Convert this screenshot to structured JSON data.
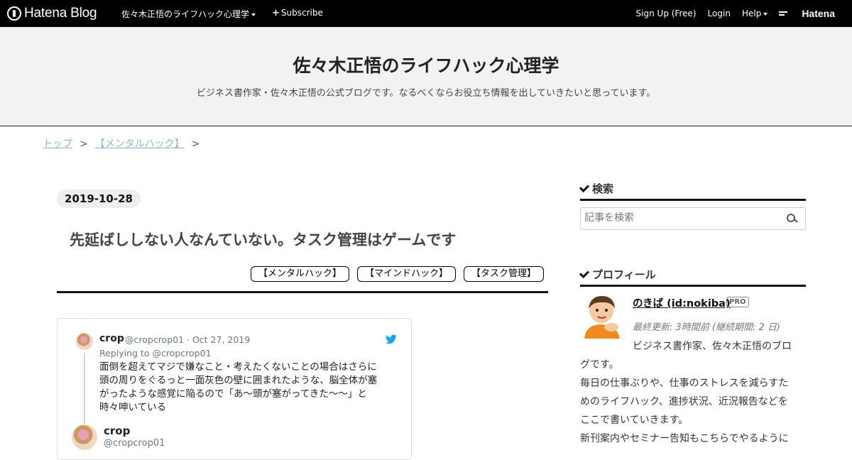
{
  "topbar": {
    "logo_text": "Hatena Blog",
    "blog_menu": "佐々木正悟のライフハック心理学",
    "subscribe": "Subscribe",
    "signup": "Sign Up (Free)",
    "login": "Login",
    "help": "Help",
    "hatena_brand": "Hatena"
  },
  "header": {
    "title": "佐々木正悟のライフハック心理学",
    "description": "ビジネス書作家・佐々木正悟の公式ブログです。なるべくならお役立ち情報を出していきたいと思っています。"
  },
  "breadcrumb": {
    "items": [
      "トップ",
      "【メンタルハック】"
    ],
    "separator": ">"
  },
  "entry": {
    "date": "2019-10-28",
    "title": "先延ばししない人なんていない。タスク管理はゲームです",
    "categories": [
      "【メンタルハック】",
      "【マインドハック】",
      "【タスク管理】"
    ]
  },
  "tweet": {
    "name": "crop",
    "handle_date": "@cropcrop01 · Oct 27, 2019",
    "replying_to": "Replying to @cropcrop01",
    "text_lines": [
      "面倒を超えてマジで嫌なこと・考えたくないことの場合はさらに",
      "頭の周りをぐるっと一面灰色の壁に囲まれたような、脳全体が塞",
      "がったような感覚に陥るので「あ〜頭が塞がってきた〜〜」と",
      "時々呻いている"
    ],
    "author_name": "crop",
    "author_handle": "@cropcrop01"
  },
  "sidebar": {
    "search_heading": "検索",
    "search_placeholder": "記事を検索",
    "profile_heading": "プロフィール",
    "profile": {
      "name": "のきば (id:nokiba)",
      "badge": "PRO",
      "updated": "最終更新: 3時間前 (継続期間: 2 日)",
      "bio_lines": [
        "ビジネス書作家、佐々木正悟のブロ",
        "グです。",
        "毎日の仕事ぶりや、仕事のストレスを減らすた",
        "めのライフハック、進捗状況、近況報告などを",
        "ここで書いていきます。",
        "新刊案内やセミナー告知もこちらでやるように"
      ]
    }
  },
  "colors": {
    "topbar_bg": "#000000",
    "header_bg": "#f2f2f2",
    "breadcrumb_link": "#89b7cf",
    "twitter_blue": "#1da1f2"
  }
}
